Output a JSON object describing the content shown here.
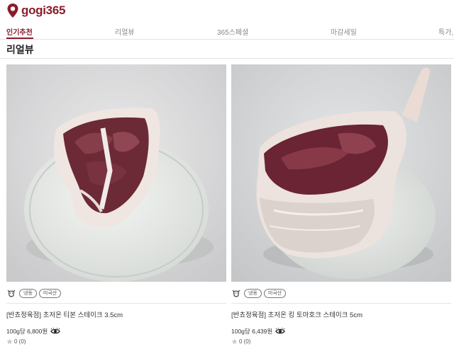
{
  "header": {
    "logo_text": "gogi365"
  },
  "tabs": [
    {
      "label": "인기추천",
      "active": true
    },
    {
      "label": "리얼뷰",
      "active": false
    },
    {
      "label": "365스페셜",
      "active": false
    },
    {
      "label": "마감세일",
      "active": false
    },
    {
      "label": "특가,",
      "active": false
    }
  ],
  "section": {
    "title": "리얼뷰"
  },
  "products": [
    {
      "badges": [
        "냉동",
        "미국산"
      ],
      "title": "[반쵸정육점] 초저온 티본 스테이크 3.5cm",
      "price": "100g당 6,800원",
      "rating": "0 (0)"
    },
    {
      "badges": [
        "냉동",
        "미국산"
      ],
      "title": "[반쵸정육점] 초저온 킹 토마호크 스테이크 5cm",
      "price": "100g당 6,439원",
      "rating": "0 (0)"
    }
  ],
  "colors": {
    "brand": "#8a1c2b",
    "border": "#e3e3e3"
  },
  "icons": [
    "location-pin-icon",
    "cow-icon",
    "eye-icon",
    "star-icon"
  ]
}
